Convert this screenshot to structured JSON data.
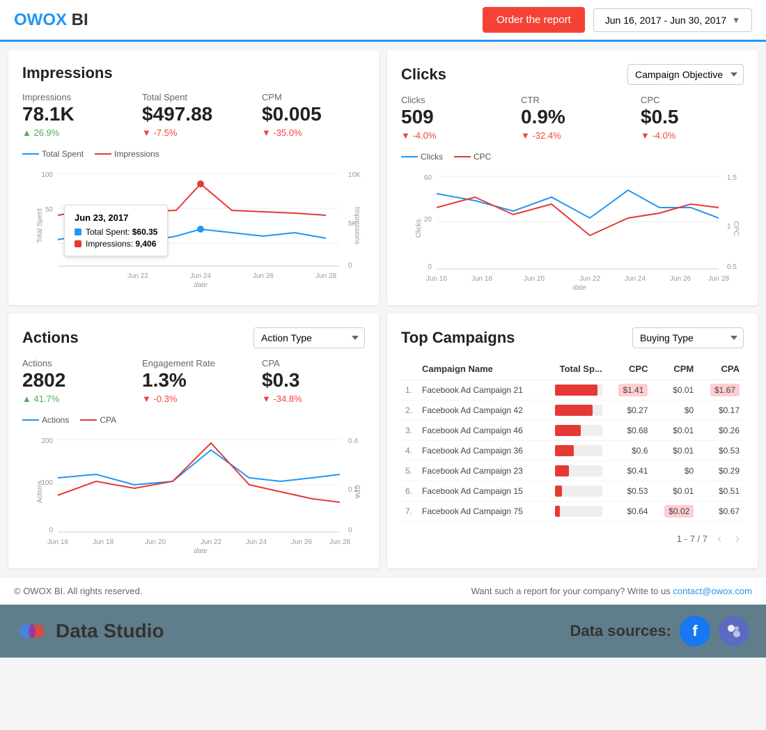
{
  "header": {
    "logo_text": "OWOX",
    "logo_suffix": "BI",
    "order_btn": "Order the report",
    "date_range": "Jun 16, 2017 - Jun 30, 2017"
  },
  "impressions": {
    "title": "Impressions",
    "metrics": [
      {
        "label": "Impressions",
        "value": "78.1K",
        "change": "▲ 26.9%",
        "up": true
      },
      {
        "label": "Total Spent",
        "value": "$497.88",
        "change": "▼ -7.5%",
        "up": false
      },
      {
        "label": "CPM",
        "value": "$0.005",
        "change": "▼ -35.0%",
        "up": false
      }
    ],
    "legend": [
      {
        "label": "Total Spent",
        "color": "#2196F3"
      },
      {
        "label": "Impressions",
        "color": "#e53935"
      }
    ],
    "tooltip": {
      "date": "Jun 23, 2017",
      "rows": [
        {
          "label": "Total Spent:",
          "value": "$60.35",
          "color": "#2196F3"
        },
        {
          "label": "Impressions:",
          "value": "9,406",
          "color": "#e53935"
        }
      ]
    }
  },
  "clicks": {
    "title": "Clicks",
    "dropdown": "Campaign Objective",
    "metrics": [
      {
        "label": "Clicks",
        "value": "509",
        "change": "▼ -4.0%",
        "up": false
      },
      {
        "label": "CTR",
        "value": "0.9%",
        "change": "▼ -32.4%",
        "up": false
      },
      {
        "label": "CPC",
        "value": "$0.5",
        "change": "▼ -4.0%",
        "up": false
      }
    ],
    "legend": [
      {
        "label": "Clicks",
        "color": "#2196F3"
      },
      {
        "label": "CPC",
        "color": "#e53935"
      }
    ]
  },
  "actions": {
    "title": "Actions",
    "dropdown": "Action Type",
    "metrics": [
      {
        "label": "Actions",
        "value": "2802",
        "change": "▲ 41.7%",
        "up": true
      },
      {
        "label": "Engagement Rate",
        "value": "1.3%",
        "change": "▼ -0.3%",
        "up": false
      },
      {
        "label": "CPA",
        "value": "$0.3",
        "change": "▼ -34.8%",
        "up": false
      }
    ],
    "legend": [
      {
        "label": "Actions",
        "color": "#2196F3"
      },
      {
        "label": "CPA",
        "color": "#e53935"
      }
    ]
  },
  "top_campaigns": {
    "title": "Top Campaigns",
    "dropdown": "Buying Type",
    "columns": [
      "Campaign Name",
      "Total Sp...",
      "CPC",
      "CPM",
      "CPA"
    ],
    "rows": [
      {
        "num": "1.",
        "name": "Facebook Ad Campaign 21",
        "bar": 90,
        "cpc": "$1.41",
        "cpm": "$0.01",
        "cpa": "$1.67",
        "highlight_cpc": false,
        "highlight_cpm": false,
        "highlight_cpa": false
      },
      {
        "num": "2.",
        "name": "Facebook Ad Campaign 42",
        "bar": 80,
        "cpc": "$0.27",
        "cpm": "$0",
        "cpa": "$0.17",
        "highlight_cpc": false,
        "highlight_cpm": false,
        "highlight_cpa": false
      },
      {
        "num": "3.",
        "name": "Facebook Ad Campaign 46",
        "bar": 55,
        "cpc": "$0.68",
        "cpm": "$0.01",
        "cpa": "$0.26",
        "highlight_cpc": false,
        "highlight_cpm": false,
        "highlight_cpa": false
      },
      {
        "num": "4.",
        "name": "Facebook Ad Campaign 36",
        "bar": 40,
        "cpc": "$0.6",
        "cpm": "$0.01",
        "cpa": "$0.53",
        "highlight_cpc": false,
        "highlight_cpm": false,
        "highlight_cpa": false
      },
      {
        "num": "5.",
        "name": "Facebook Ad Campaign 23",
        "bar": 30,
        "cpc": "$0.41",
        "cpm": "$0",
        "cpa": "$0.29",
        "highlight_cpc": false,
        "highlight_cpm": false,
        "highlight_cpa": false
      },
      {
        "num": "6.",
        "name": "Facebook Ad Campaign 15",
        "bar": 15,
        "cpc": "$0.53",
        "cpm": "$0.01",
        "cpa": "$0.51",
        "highlight_cpc": false,
        "highlight_cpm": false,
        "highlight_cpa": false
      },
      {
        "num": "7.",
        "name": "Facebook Ad Campaign 75",
        "bar": 10,
        "cpc": "$0.64",
        "cpm": "$0.02",
        "cpa": "$0.67",
        "highlight_cpc": false,
        "highlight_cpm": true,
        "highlight_cpa": false
      }
    ],
    "pagination": "1 - 7 / 7"
  },
  "footer": {
    "copyright": "© OWOX BI. All rights reserved.",
    "cta": "Want such a report for your company? Write to us",
    "email": "contact@owox.com",
    "data_studio_label": "Data Studio",
    "data_sources_label": "Data sources:"
  }
}
